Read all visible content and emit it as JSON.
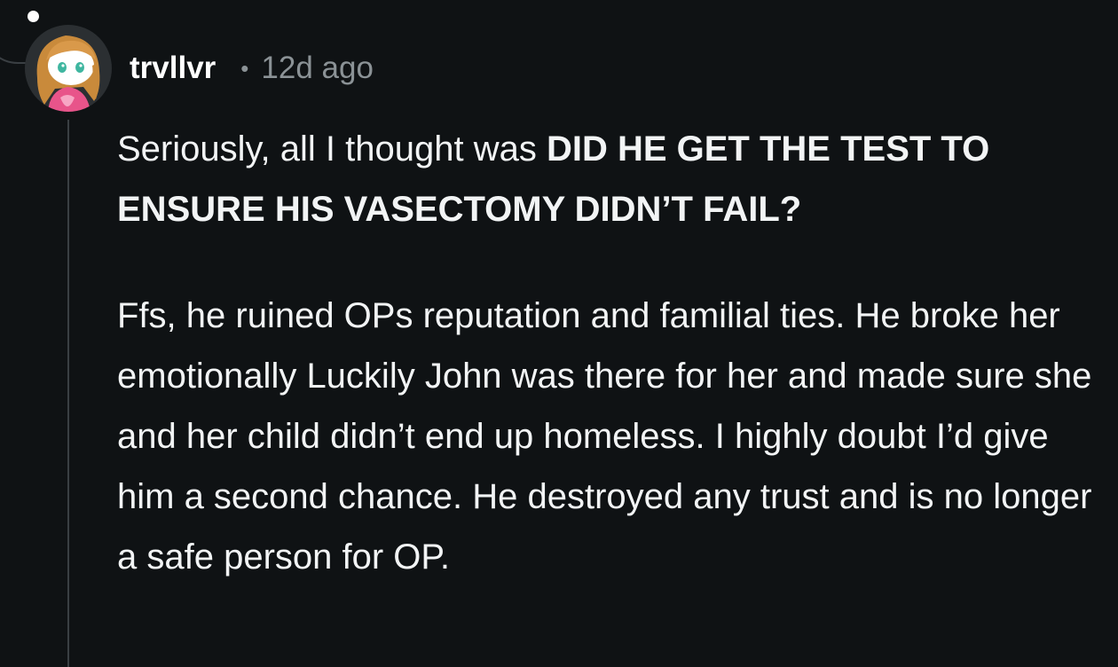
{
  "comment": {
    "author": "trvllvr",
    "separator": "•",
    "timestamp": "12d ago",
    "avatar_icon": "reddit-snoo-avatar-icon",
    "paragraph1": {
      "plain": "Seriously, all I thought was ",
      "bold": "DID HE GET THE TEST TO ENSURE HIS VASECTOMY DIDN’T FAIL?"
    },
    "paragraph2": "Ffs, he ruined OPs reputation and familial ties. He broke her emotionally Luckily John was there for her and made sure she and her child didn’t end up homeless. I highly doubt I’d give him a second chance. He destroyed any trust and is no longer a safe person for OP."
  },
  "colors": {
    "background": "#0f1214",
    "text": "#f2f4f5",
    "meta": "#8b9296",
    "thread_line": "#3a3f43"
  }
}
